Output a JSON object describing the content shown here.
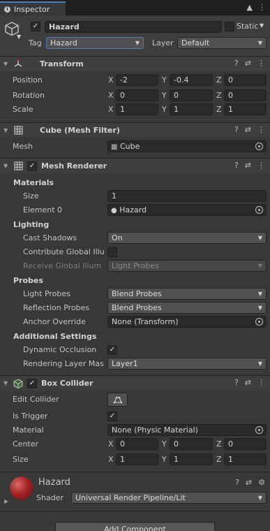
{
  "tab": {
    "label": "Inspector"
  },
  "gameobject": {
    "name": "Hazard",
    "static_label": "Static",
    "tag_label": "Tag",
    "tag_value": "Hazard",
    "layer_label": "Layer",
    "layer_value": "Default"
  },
  "transform": {
    "title": "Transform",
    "position_label": "Position",
    "rotation_label": "Rotation",
    "scale_label": "Scale",
    "axes": [
      "X",
      "Y",
      "Z"
    ],
    "position": [
      "-2",
      "-0.4",
      "0"
    ],
    "rotation": [
      "0",
      "0",
      "0"
    ],
    "scale": [
      "1",
      "1",
      "1"
    ]
  },
  "mesh_filter": {
    "title": "Cube (Mesh Filter)",
    "mesh_label": "Mesh",
    "mesh_value": "Cube"
  },
  "mesh_renderer": {
    "title": "Mesh Renderer",
    "materials_header": "Materials",
    "size_label": "Size",
    "size_value": "1",
    "element0_label": "Element 0",
    "element0_value": "Hazard",
    "lighting_header": "Lighting",
    "cast_shadows_label": "Cast Shadows",
    "cast_shadows_value": "On",
    "contribute_gi_label": "Contribute Global Illu",
    "receive_gi_label": "Receive Global Illum",
    "receive_gi_value": "Light Probes",
    "probes_header": "Probes",
    "light_probes_label": "Light Probes",
    "light_probes_value": "Blend Probes",
    "reflection_probes_label": "Reflection Probes",
    "reflection_probes_value": "Blend Probes",
    "anchor_override_label": "Anchor Override",
    "anchor_override_value": "None (Transform)",
    "additional_header": "Additional Settings",
    "dynamic_occlusion_label": "Dynamic Occlusion",
    "rendering_layer_label": "Rendering Layer Mas",
    "rendering_layer_value": "Layer1"
  },
  "box_collider": {
    "title": "Box Collider",
    "edit_collider_label": "Edit Collider",
    "is_trigger_label": "Is Trigger",
    "material_label": "Material",
    "material_value": "None (Physic Material)",
    "center_label": "Center",
    "size_label": "Size",
    "center": [
      "0",
      "0",
      "0"
    ],
    "size": [
      "1",
      "1",
      "1"
    ]
  },
  "material": {
    "name": "Hazard",
    "shader_label": "Shader",
    "shader_value": "Universal Render Pipeline/Lit"
  },
  "add_component_label": "Add Component",
  "colors": {
    "accent": "#4c7dbd",
    "background": "#383838",
    "header": "#3e3e3e",
    "field": "#2a2a2a"
  }
}
